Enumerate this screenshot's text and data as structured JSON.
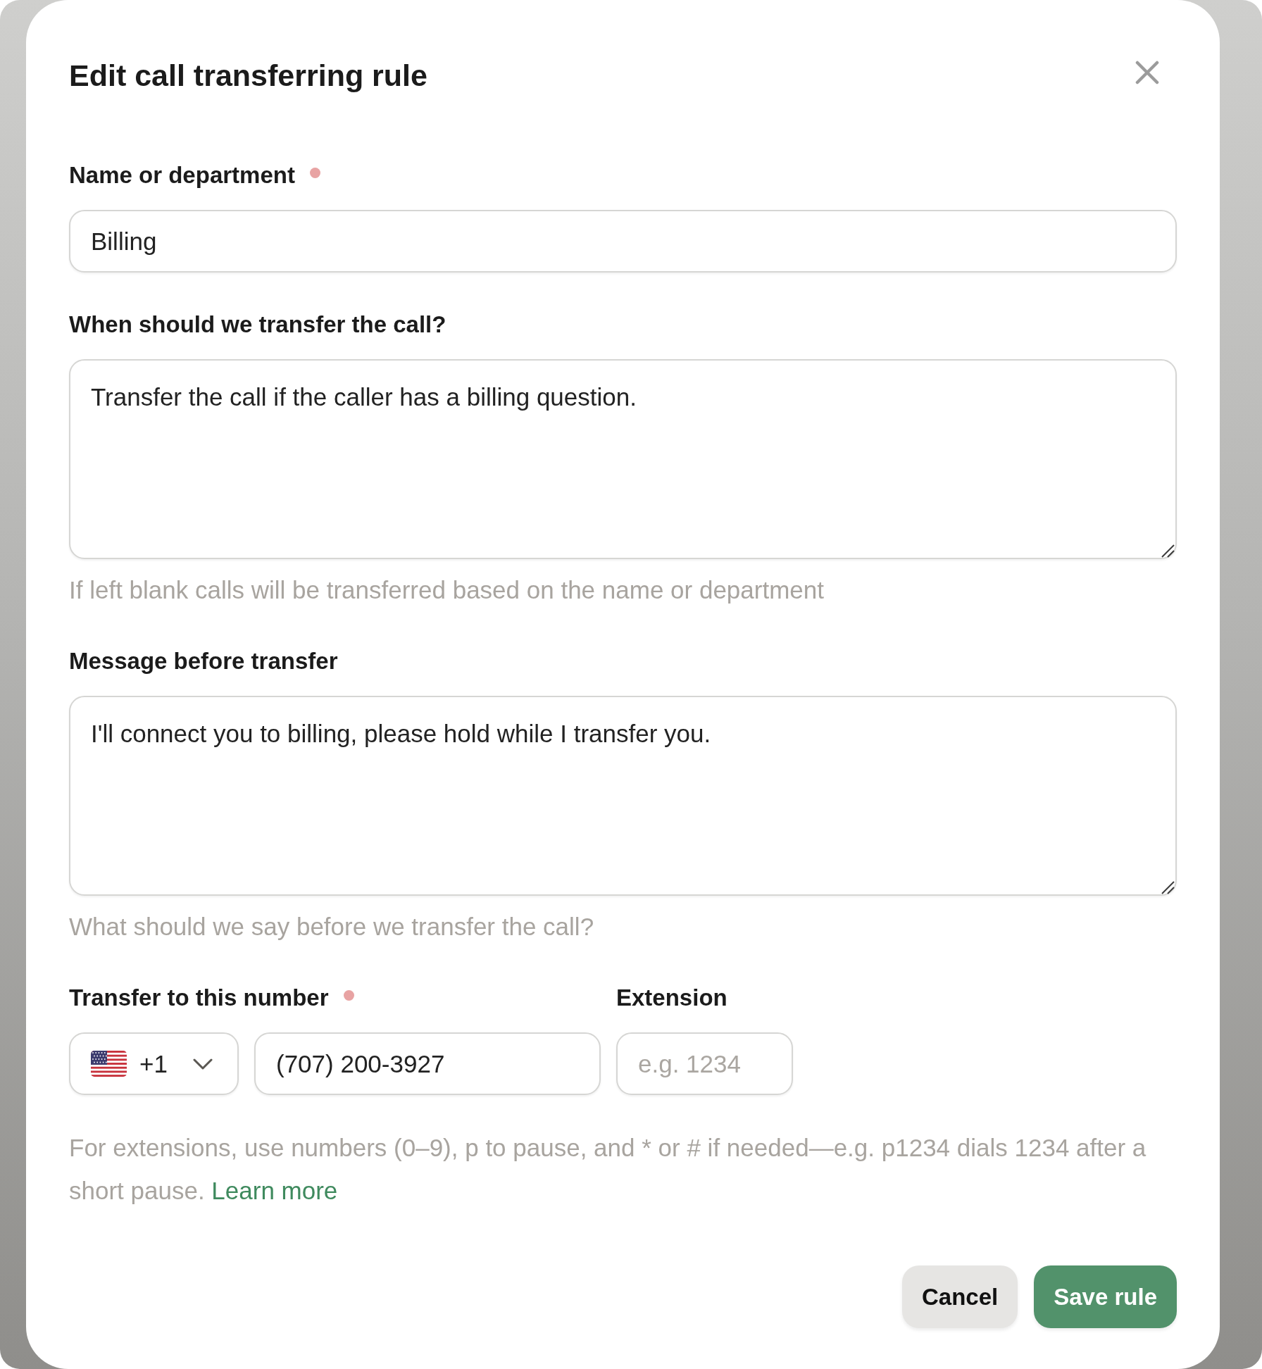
{
  "dialog": {
    "title": "Edit call transferring rule"
  },
  "fields": [
    {
      "kind": "text",
      "label": "Name or department",
      "required": true,
      "value": "Billing"
    },
    {
      "kind": "textarea",
      "label": "When should we transfer the call?",
      "required": false,
      "value": "Transfer the call if the caller has a billing question.",
      "hint": "If left blank calls will be transferred based on the name or department"
    },
    {
      "kind": "textarea",
      "label": "Message before transfer",
      "required": false,
      "value": "I'll connect you to billing, please hold while I transfer you.",
      "hint": "What should we say before we transfer the call?"
    }
  ],
  "phone": {
    "label": "Transfer to this number",
    "required": true,
    "country_code": "+1",
    "number": "(707) 200-3927",
    "extension": {
      "label": "Extension",
      "placeholder": "e.g. 1234"
    },
    "help": "For extensions, use numbers (0–9), p to pause, and * or # if needed—e.g. p1234 dials 1234 after a short pause.",
    "help_link": "Learn more"
  },
  "buttons": [
    {
      "label": "Cancel",
      "kind": "secondary"
    },
    {
      "label": "Save rule",
      "kind": "primary"
    }
  ]
}
